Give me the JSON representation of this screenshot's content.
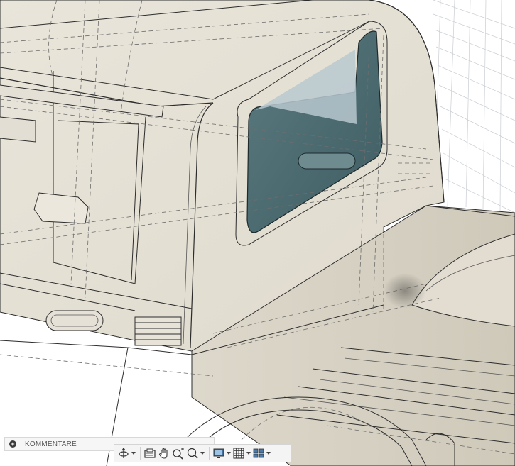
{
  "comments": {
    "label": "KOMMENTARE",
    "add_icon": "plus-circle-icon"
  },
  "toolbar": {
    "tools": [
      {
        "name": "orbit-icon",
        "has_menu": true
      },
      {
        "name": "look-at-icon",
        "has_menu": false
      },
      {
        "name": "pan-icon",
        "has_menu": false
      },
      {
        "name": "zoom-icon",
        "has_menu": false
      },
      {
        "name": "fit-icon",
        "has_menu": true
      },
      {
        "name": "display-settings-icon",
        "has_menu": true
      },
      {
        "name": "grid-snap-icon",
        "has_menu": true
      },
      {
        "name": "viewports-icon",
        "has_menu": true
      }
    ]
  },
  "colors": {
    "body_fill": "#ebe7dc",
    "edge_line": "#2c2c2c",
    "hidden_line": "#6d6d6d",
    "glass": "#4e6e74",
    "grid": "#c9cdd3",
    "toolbar_bg": "#f4f4f4"
  }
}
